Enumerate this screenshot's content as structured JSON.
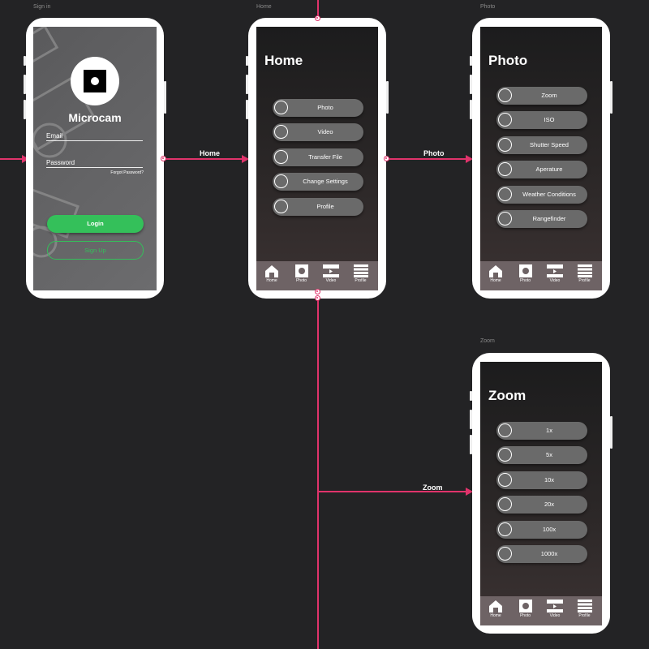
{
  "artboards": {
    "signin": "Sign in",
    "home": "Home",
    "photo": "Photo",
    "zoom": "Zoom"
  },
  "signin": {
    "app_name": "Microcam",
    "email_label": "Email",
    "password_label": "Password",
    "forgot": "Forgot Password?",
    "login": "Login",
    "signup": "Sign Up",
    "login_color": "#34c05a"
  },
  "home": {
    "title": "Home",
    "items": [
      "Photo",
      "Video",
      "Transfer File",
      "Change Settings",
      "Profile"
    ]
  },
  "photo": {
    "title": "Photo",
    "items": [
      "Zoom",
      "ISO",
      "Shutter Speed",
      "Aperature",
      "Weather Conditions",
      "Rangefinder"
    ]
  },
  "zoom": {
    "title": "Zoom",
    "items": [
      "1x",
      "5x",
      "10x",
      "20x",
      "100x",
      "1000x"
    ]
  },
  "tabbar": [
    {
      "label": "Home",
      "icon": "home-icon"
    },
    {
      "label": "Photo",
      "icon": "camera-icon"
    },
    {
      "label": "Video",
      "icon": "video-icon"
    },
    {
      "label": "Profile",
      "icon": "menu-icon"
    }
  ],
  "flows": {
    "home": "Home",
    "photo": "Photo",
    "zoom": "Zoom"
  },
  "accent": "#e0336b"
}
